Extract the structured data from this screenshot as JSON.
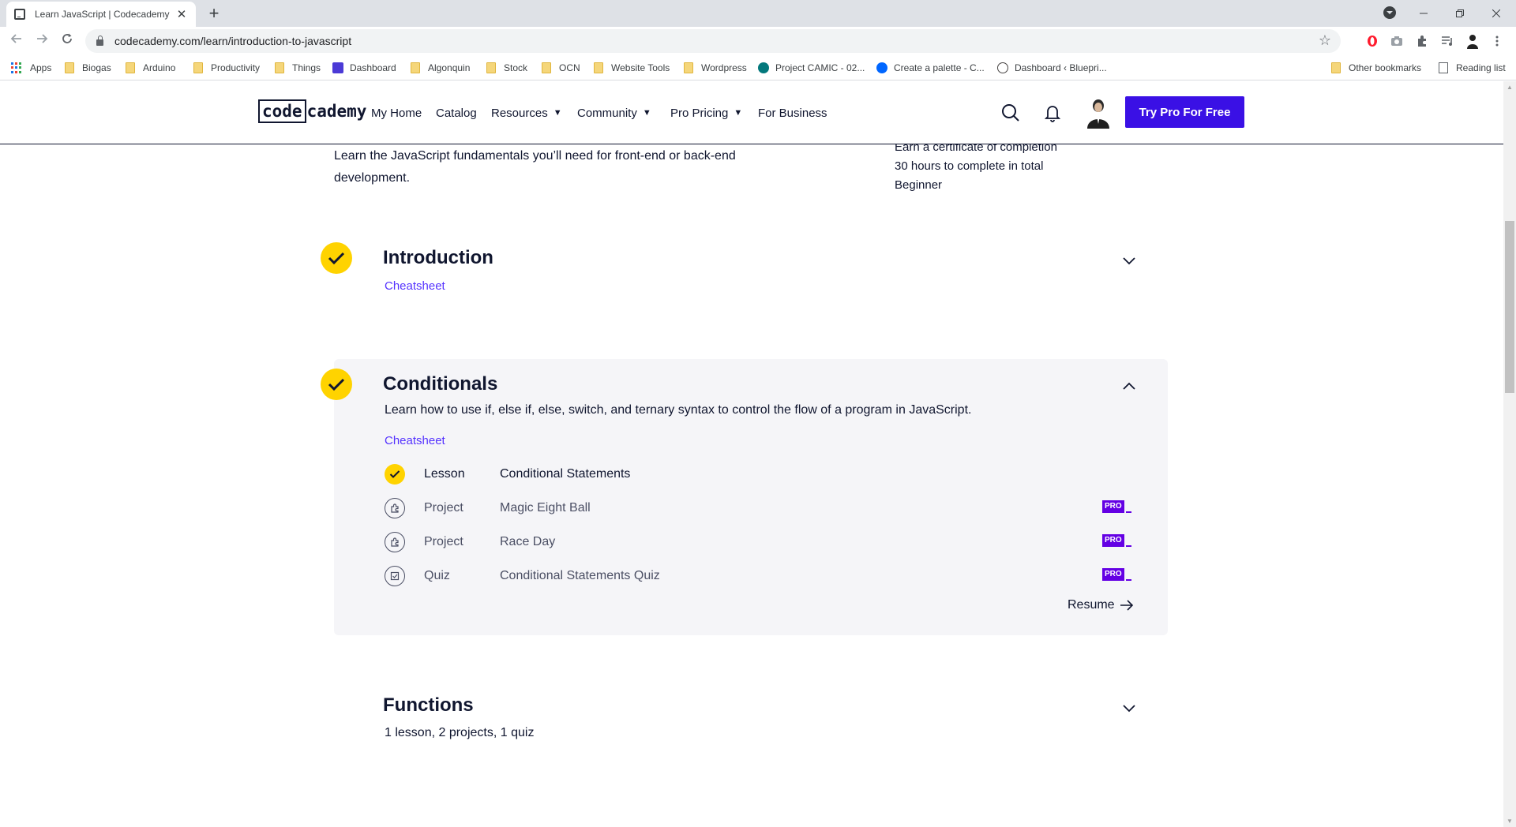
{
  "browser": {
    "tab_title": "Learn JavaScript | Codecademy",
    "tab_close": "✕",
    "new_tab": "+",
    "url": "codecademy.com/learn/introduction-to-javascript",
    "bookmarks": [
      {
        "label": "Apps",
        "icon": "apps-grid-icon"
      },
      {
        "label": "Biogas",
        "icon": "folder-icon"
      },
      {
        "label": "Arduino",
        "icon": "folder-icon"
      },
      {
        "label": "Productivity",
        "icon": "folder-icon"
      },
      {
        "label": "Things",
        "icon": "folder-icon"
      },
      {
        "label": "Dashboard",
        "icon": "dashboard-favicon"
      },
      {
        "label": "Algonquin",
        "icon": "folder-icon"
      },
      {
        "label": "Stock",
        "icon": "folder-icon"
      },
      {
        "label": "OCN",
        "icon": "folder-icon"
      },
      {
        "label": "Website Tools",
        "icon": "folder-icon"
      },
      {
        "label": "Wordpress",
        "icon": "folder-icon"
      },
      {
        "label": "Project CAMIC - 02...",
        "icon": "sharepoint-favicon"
      },
      {
        "label": "Create a palette - C...",
        "icon": "coolors-favicon"
      },
      {
        "label": "Dashboard ‹ Bluepri...",
        "icon": "wordpress-favicon"
      }
    ],
    "other_bookmarks": "Other bookmarks",
    "reading_list": "Reading list"
  },
  "header": {
    "logo_code": "code",
    "logo_rest": "cademy",
    "nav": {
      "my_home": "My Home",
      "catalog": "Catalog",
      "resources": "Resources",
      "community": "Community",
      "pro_pricing": "Pro Pricing",
      "for_business": "For Business"
    },
    "caret": "▼",
    "cta": "Try Pro For Free"
  },
  "course": {
    "description": "Learn the JavaScript fundamentals you’ll need for front-end or back-end development.",
    "meta": {
      "certificate": "Earn a certificate of completion",
      "duration": "30 hours to complete in total",
      "level": "Beginner"
    }
  },
  "modules": {
    "introduction": {
      "title": "Introduction",
      "cheatsheet": "Cheatsheet",
      "completed": true
    },
    "conditionals": {
      "title": "Conditionals",
      "description": "Learn how to use if, else if, else, switch, and ternary syntax to control the flow of a program in JavaScript.",
      "cheatsheet": "Cheatsheet",
      "completed": true,
      "items": [
        {
          "type": "Lesson",
          "name": "Conditional Statements",
          "status": "complete"
        },
        {
          "type": "Project",
          "name": "Magic Eight Ball",
          "pro": "PRO"
        },
        {
          "type": "Project",
          "name": "Race Day",
          "pro": "PRO"
        },
        {
          "type": "Quiz",
          "name": "Conditional Statements Quiz",
          "pro": "PRO"
        }
      ],
      "resume": "Resume"
    },
    "functions": {
      "title": "Functions",
      "summary": "1 lesson, 2 projects, 1 quiz"
    }
  },
  "colors": {
    "brand_purple": "#3a10e5",
    "check_yellow": "#ffd300",
    "link_purple": "#5533ff",
    "pro_purple": "#6400e4",
    "navy": "#10162f"
  }
}
